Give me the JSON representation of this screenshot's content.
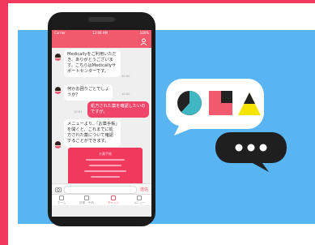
{
  "phone": {
    "status_left": "Carrier",
    "status_time": "12:00 AM",
    "status_right": "100%",
    "messages": [
      {
        "type": "in",
        "text": "Medicallyをご利用いただき、ありがとうございます。こちらはMedicallyサポートセンターです。",
        "time": "10:00"
      },
      {
        "type": "in",
        "text": "何かお困りごとでしょうか？",
        "time": "10:00"
      },
      {
        "type": "out",
        "text": "処方された薬を確認したいのですが。",
        "time": "10:01"
      },
      {
        "type": "in",
        "text": "メニューより、「お薬手帳」を開くと、これまでに処方された薬について確認することができます。",
        "time": "10:01"
      }
    ],
    "card_title": "お薬手帳",
    "send_label": "送信",
    "tabs": [
      {
        "label": "ホーム"
      },
      {
        "label": "診察・予約"
      },
      {
        "label": "チャット"
      },
      {
        "label": "メニュー"
      }
    ]
  },
  "illustration": {
    "accent_colors": {
      "frame": "#f0395d",
      "background": "#58b5f2",
      "teal": "#3fb6c2",
      "yellow": "#f5e400",
      "dark": "#222222"
    }
  }
}
